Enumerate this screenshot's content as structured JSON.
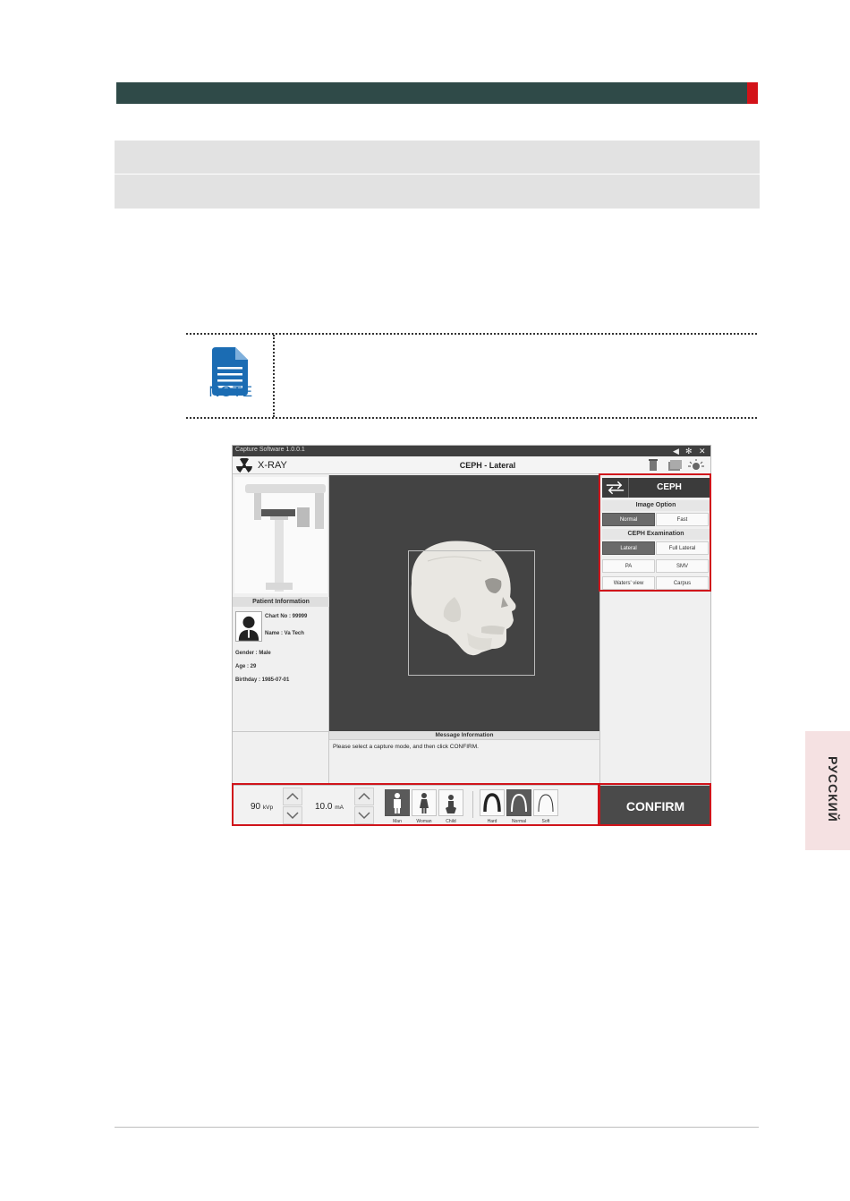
{
  "note": {
    "label": "NOTE"
  },
  "screenshot": {
    "app_title": "Capture Software  1.0.0.1",
    "toolbar": {
      "xray_label": "X-RAY",
      "mode_title": "CEPH - Lateral"
    },
    "patient": {
      "header": "Patient Information",
      "chart_no": "Chart No : 99999",
      "name": "Name : Va Tech",
      "gender": "Gender : Male",
      "age": "Age : 29",
      "birthday": "Birthday : 1985-07-01"
    },
    "right_panel": {
      "mode": "CEPH",
      "image_option_label": "Image Option",
      "image_options": [
        "Normal",
        "Fast"
      ],
      "exam_label": "CEPH Examination",
      "exam_options": [
        "Lateral",
        "Full Lateral",
        "PA",
        "SMV",
        "Waters' view",
        "Carpus"
      ]
    },
    "message": {
      "header": "Message Information",
      "text": "Please select a capture mode, and then click CONFIRM."
    },
    "bottom": {
      "kvp_value": "90",
      "kvp_unit": "kVp",
      "ma_value": "10.0",
      "ma_unit": "mA",
      "patient_types": [
        "Man",
        "Woman",
        "Child"
      ],
      "arch_types": [
        "Hard",
        "Normal",
        "Soft"
      ],
      "confirm_label": "CONFIRM"
    }
  },
  "side_tab": {
    "label": "РУССКИЙ"
  },
  "colors": {
    "title_bar": "#2f4a48",
    "accent_red": "#d31218",
    "note_blue": "#1b6cb3",
    "highlight": "#d0141b"
  }
}
